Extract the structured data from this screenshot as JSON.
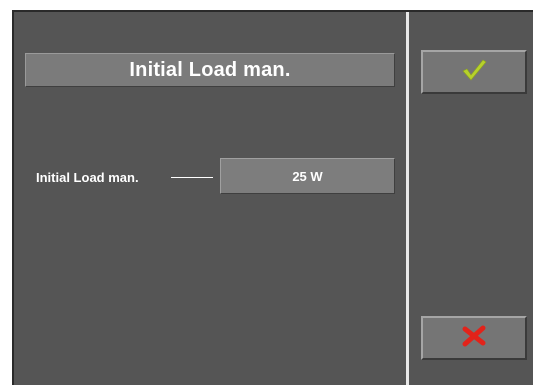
{
  "header": {
    "title": "Initial Load man."
  },
  "parameter": {
    "label": "Initial Load man.",
    "value": "25 W"
  },
  "actions": {
    "confirm_icon": "checkmark-icon",
    "cancel_icon": "cross-icon"
  },
  "colors": {
    "background": "#555555",
    "confirm": "#b6d12b",
    "cancel": "#e2231a"
  }
}
